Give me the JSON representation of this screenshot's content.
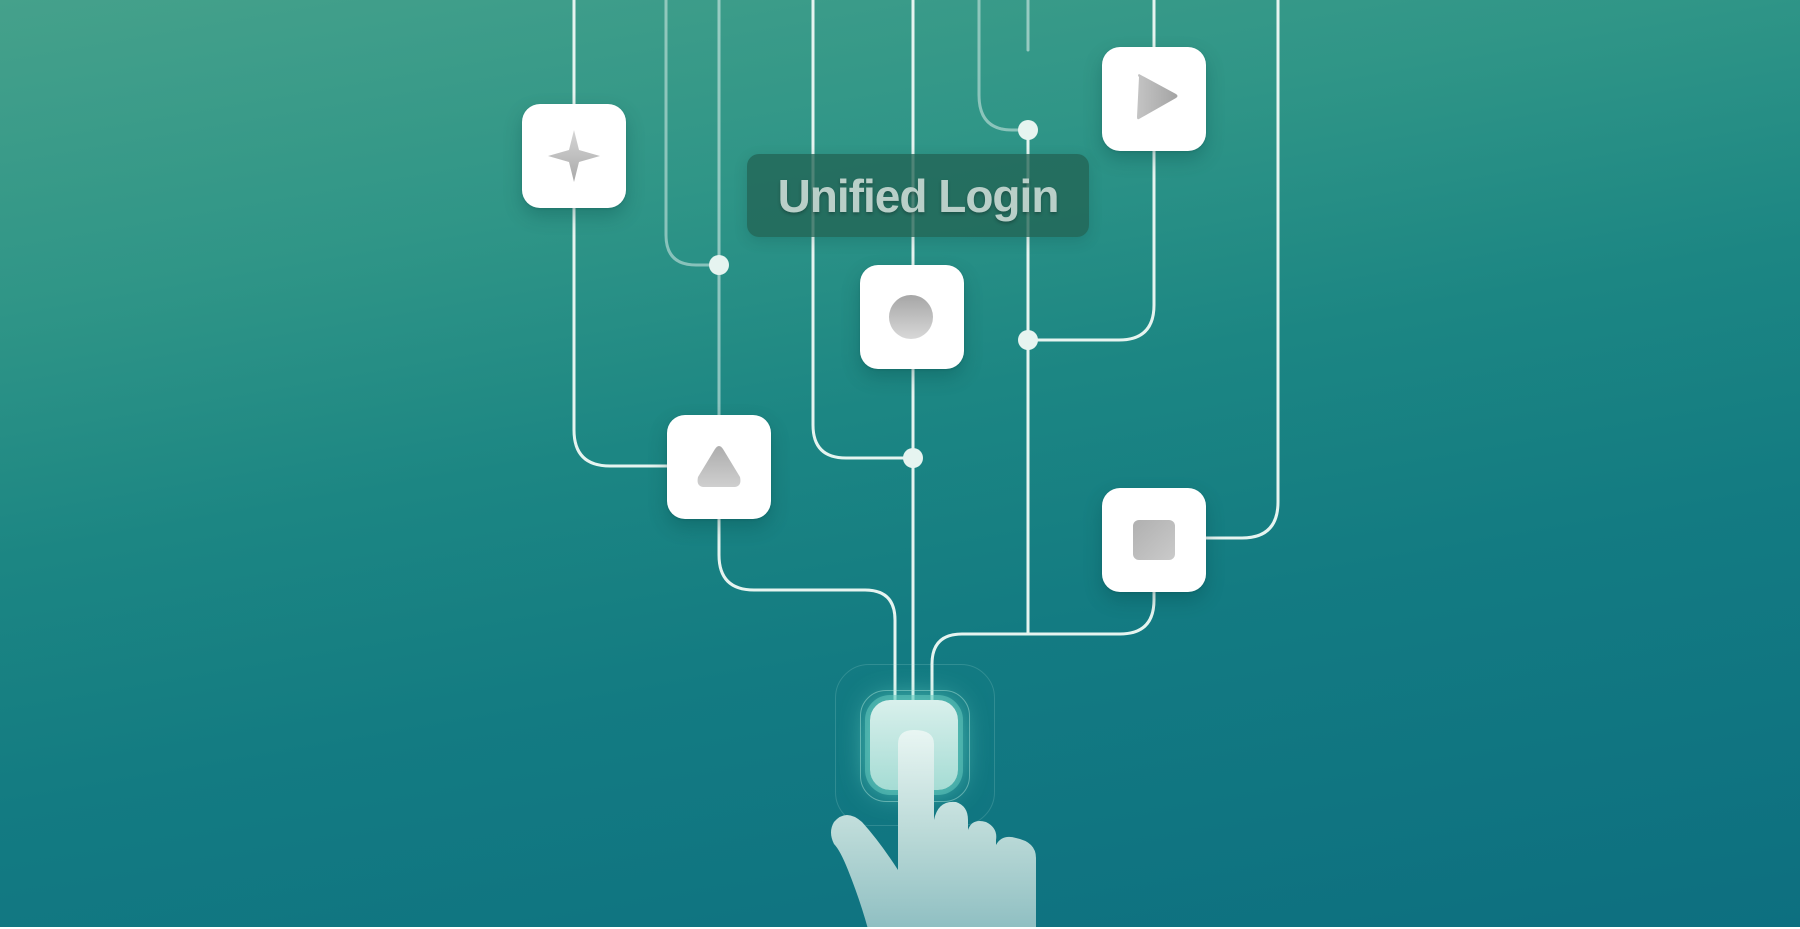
{
  "title": "Unified Login",
  "colors": {
    "background_top": "#45a18b",
    "background_bottom": "#0d6f80",
    "wire": "#e6f4f0",
    "tile": "#ffffff",
    "icon_gray": "#bdbdbd",
    "title_pill": "#226454",
    "title_text": "#b9cfc8",
    "button_glow": "#a5dcd4"
  },
  "icons": [
    "sparkle-icon",
    "play-icon",
    "circle-icon",
    "triangle-icon",
    "square-icon",
    "pointing-hand-icon"
  ]
}
